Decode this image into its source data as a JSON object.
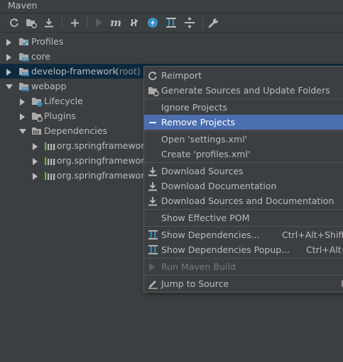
{
  "panel": {
    "title": "Maven"
  },
  "toolbar": {
    "buttons": [
      {
        "name": "reload-icon"
      },
      {
        "name": "generate-sources-icon"
      },
      {
        "name": "download-icon"
      },
      {
        "name": "add-icon"
      },
      {
        "name": "run-icon"
      },
      {
        "name": "execute-goal-icon"
      },
      {
        "name": "toggle-offline-icon"
      },
      {
        "name": "skip-tests-icon"
      },
      {
        "name": "show-dependencies-icon"
      },
      {
        "name": "collapse-all-icon"
      },
      {
        "name": "settings-icon"
      }
    ],
    "execute_goal_glyph": "m"
  },
  "tree": {
    "profiles": "Profiles",
    "core": "core",
    "develop": "develop-framework",
    "develop_suffix": "(root)",
    "webapp": "webapp",
    "lifecycle": "Lifecycle",
    "plugins": "Plugins",
    "dependencies": "Dependencies",
    "deps": [
      "org.springframework",
      "org.springframework",
      "org.springframework"
    ]
  },
  "menu": {
    "reimport": "Reimport",
    "generate": "Generate Sources and Update Folders",
    "ignore": "Ignore Projects",
    "remove": "Remove Projects",
    "open_settings": "Open 'settings.xml'",
    "create_profiles": "Create 'profiles.xml'",
    "download_sources": "Download Sources",
    "download_docs": "Download Documentation",
    "download_both": "Download Sources and Documentation",
    "effective_pom": "Show Effective POM",
    "show_deps": "Show Dependencies...",
    "show_deps_shortcut": "Ctrl+Alt+Shift+",
    "show_deps_popup": "Show Dependencies Popup...",
    "show_deps_popup_shortcut": "Ctrl+Alt+",
    "run_build": "Run Maven Build",
    "jump": "Jump to Source",
    "jump_shortcut": "F"
  },
  "colors": {
    "background": "#3c3f41",
    "selection": "#0d293e",
    "highlight": "#4b6eaf",
    "accent_blue": "#3592c4",
    "text": "#bbbbbb"
  }
}
